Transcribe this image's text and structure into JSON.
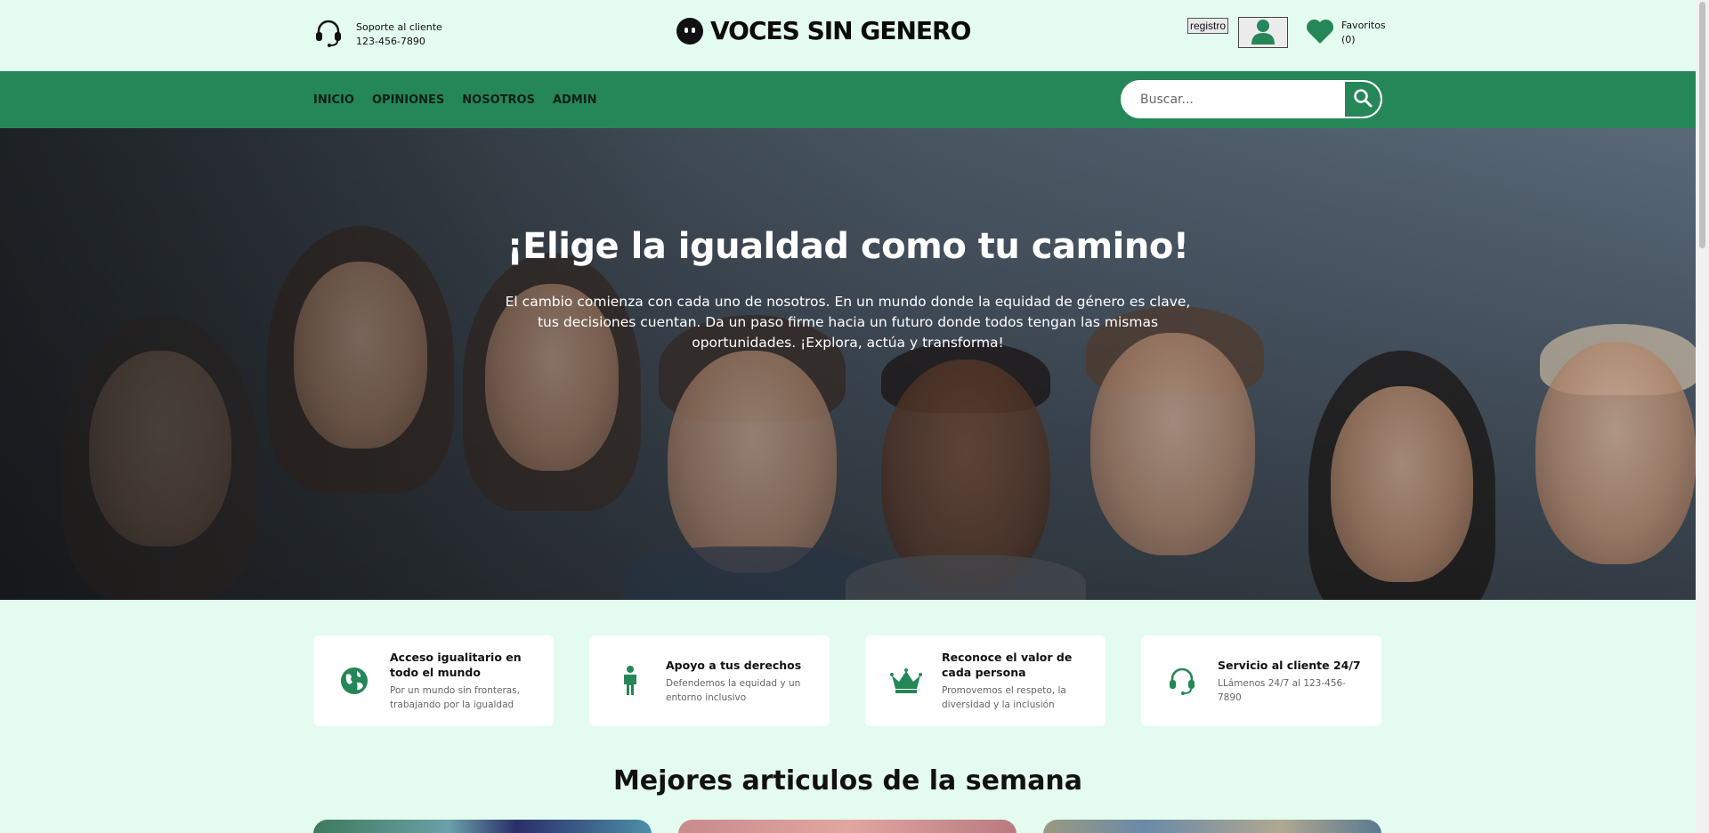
{
  "header": {
    "support_title": "Soporte al cliente",
    "support_phone": "123-456-7890",
    "brand": "VOCES SIN GENERO",
    "register_label": "registro",
    "favorites_label": "Favoritos",
    "favorites_count": "(0)"
  },
  "nav": {
    "items": [
      "INICIO",
      "OPINIONES",
      "NOSOTROS",
      "ADMIN"
    ],
    "search_placeholder": "Buscar..."
  },
  "hero": {
    "title": "¡Elige la igualdad como tu camino!",
    "text": "El cambio comienza con cada uno de nosotros. En un mundo donde la equidad de género es clave, tus decisiones cuentan. Da un paso firme hacia un futuro donde todos tengan las mismas oportunidades. ¡Explora, actúa y transforma!"
  },
  "features": [
    {
      "icon": "globe-icon",
      "title": "Acceso igualitario en todo el mundo",
      "desc": "Por un mundo sin fronteras, trabajando por la igualdad"
    },
    {
      "icon": "person-icon",
      "title": "Apoyo a tus derechos",
      "desc": "Defendemos la equidad y un entorno inclusivo"
    },
    {
      "icon": "crown-icon",
      "title": "Reconoce el valor de cada persona",
      "desc": "Promovemos el respeto, la diversidad y la inclusión"
    },
    {
      "icon": "headset-icon",
      "title": "Servicio al cliente 24/7",
      "desc": "LLámenos 24/7 al 123-456-7890"
    }
  ],
  "articles_title": "Mejores articulos de la semana",
  "colors": {
    "primary": "#258757",
    "background": "#e4fbef"
  }
}
